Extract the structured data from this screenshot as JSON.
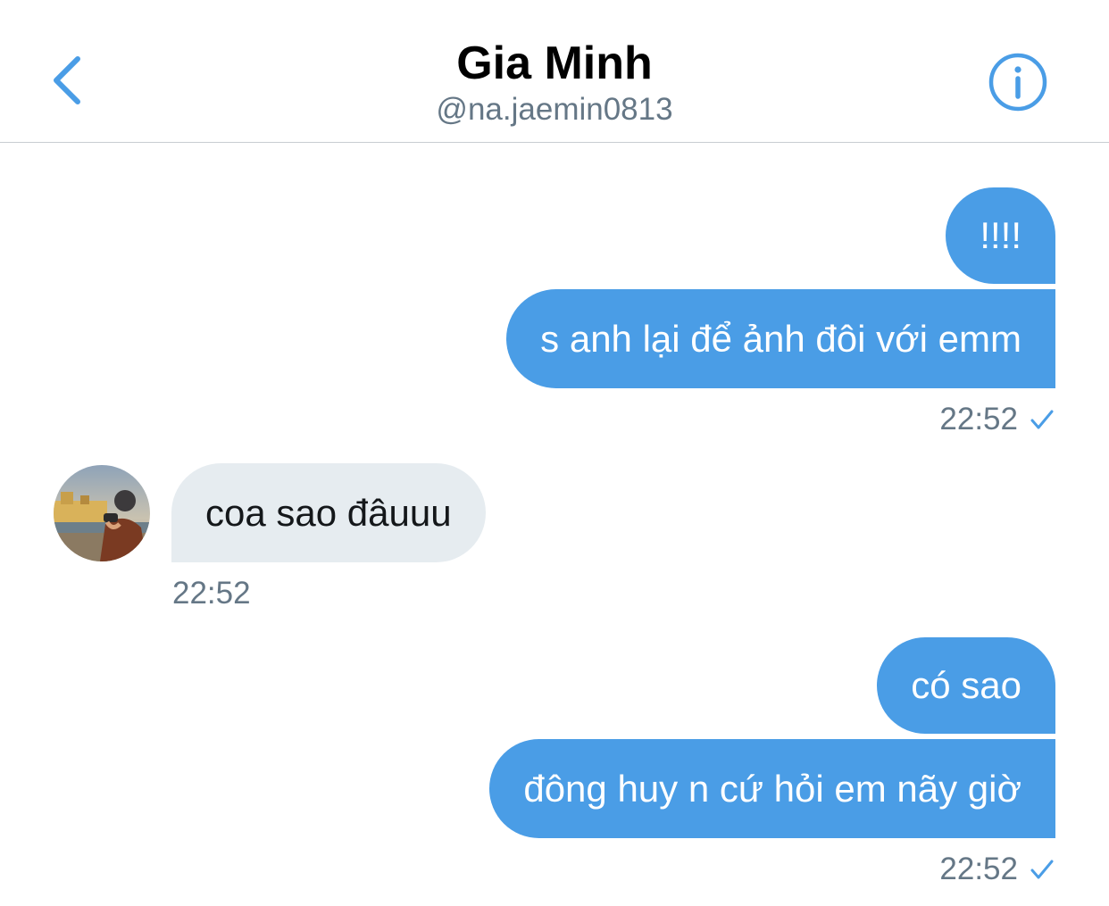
{
  "header": {
    "name": "Gia Minh",
    "handle": "@na.jaemin0813",
    "back_icon": "chevron-left-icon",
    "info_icon": "info-circle-icon"
  },
  "colors": {
    "accent": "#4a9de6",
    "received_bubble": "#e6ecf0",
    "timestamp": "#657786"
  },
  "messages": [
    {
      "direction": "sent",
      "text": "!!!!"
    },
    {
      "direction": "sent",
      "text": "s anh lại để ảnh đôi với emm",
      "time": "22:52",
      "status_icon": "checkmark-icon"
    },
    {
      "direction": "received",
      "text": "coa sao đâuuu",
      "time": "22:52",
      "avatar_icon": "avatar"
    },
    {
      "direction": "sent",
      "text": "có sao"
    },
    {
      "direction": "sent",
      "text": "đông huy n cứ hỏi em nãy giờ",
      "time": "22:52",
      "status_icon": "checkmark-icon"
    }
  ]
}
